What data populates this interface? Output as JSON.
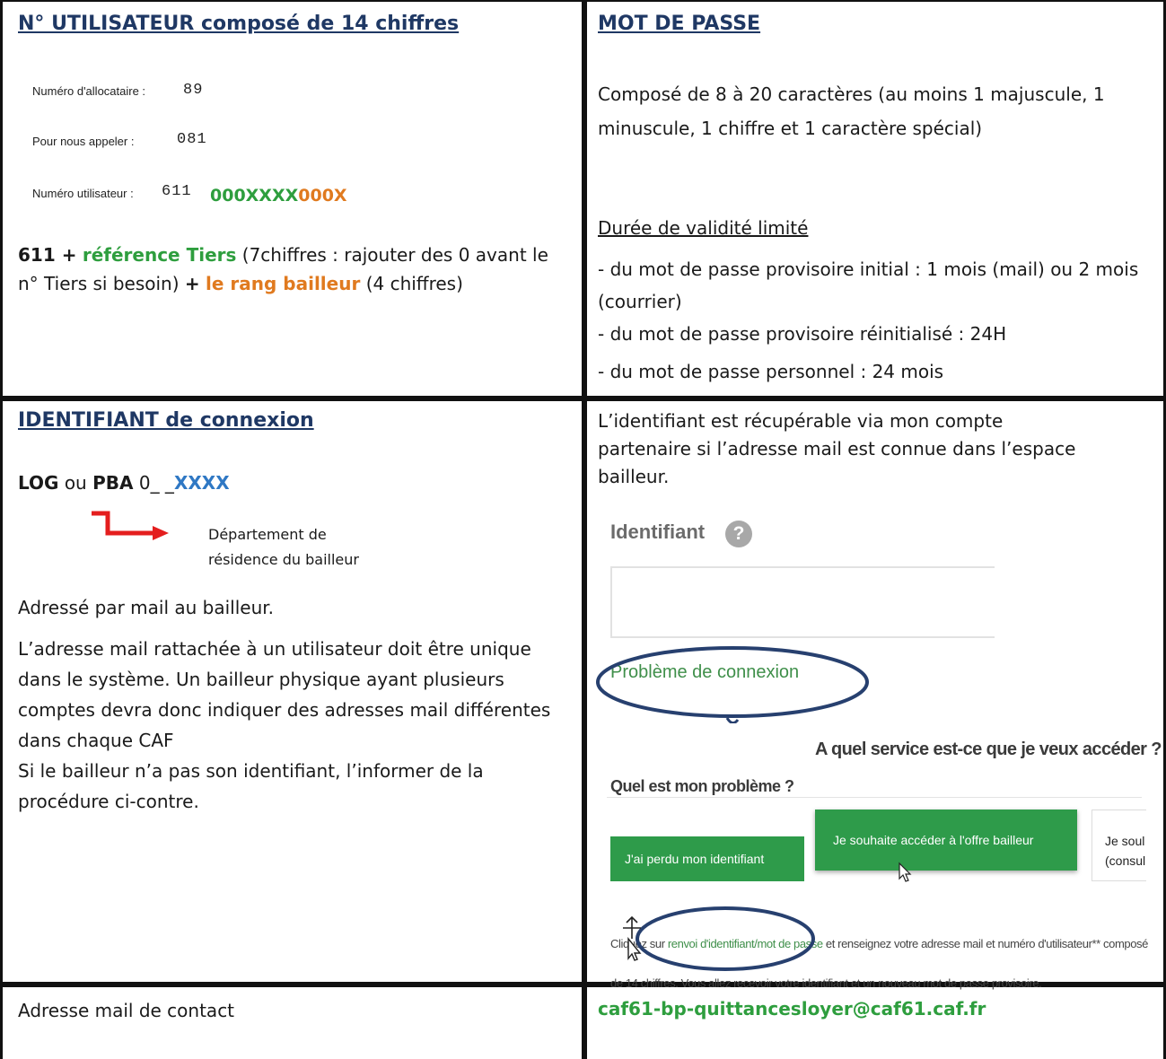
{
  "cells": {
    "user_number": {
      "heading": "N° UTILISATEUR composé de 14 chiffres",
      "sample": {
        "alloc_label": "Numéro d'allocataire :",
        "alloc_value": "89",
        "phone_label": "Pour nous appeler :",
        "phone_value": "081",
        "user_label": "Numéro utilisateur :",
        "user_value": "611",
        "code_green": "000XXXX",
        "code_orange": "000X"
      },
      "explain": {
        "prefix": "611 +",
        "tiers": "référence Tiers",
        "tiers_note": "(7chiffres : rajouter des 0 avant le n° Tiers si besoin)",
        "plus": "+",
        "rang": "le rang bailleur",
        "rang_note": "(4 chiffres)"
      }
    },
    "password": {
      "heading": "MOT DE PASSE",
      "composition": "Composé de 8 à 20 caractères (au moins 1 majuscule, 1 minuscule, 1 chiffre et 1 caractère spécial)",
      "validity_title": "Durée de validité limité",
      "validity_lines": [
        "- du mot de passe provisoire initial : 1 mois (mail) ou 2 mois (courrier)",
        "- du mot de passe provisoire réinitialisé : 24H",
        "- du mot de passe personnel : 24 mois"
      ]
    },
    "login_id": {
      "heading": "IDENTIFIANT de connexion",
      "log": "LOG",
      "ou": "ou",
      "pba": "PBA",
      "zero": "0_ _",
      "xxxx": "XXXX",
      "dept_note_1": "Département de",
      "dept_note_2": "résidence du bailleur",
      "lines": [
        "Adressé par mail au bailleur.",
        "L’adresse mail rattachée à un utilisateur doit être unique dans le système. Un bailleur physique ayant plusieurs comptes devra donc indiquer des adresses mail différentes dans chaque CAF",
        "Si le bailleur n’a pas son identifiant, l’informer de la procédure ci-contre."
      ]
    },
    "recovery": {
      "intro": "L’identifiant est récupérable via mon compte partenaire si l’adresse mail est connue dans l’espace bailleur.",
      "identifiant_label": "Identifiant",
      "help_glyph": "?",
      "problem_link": "Problème de connexion",
      "service_question": "A quel service est-ce que je veux accéder ?",
      "problem_question": "Quel est mon problème ?",
      "btn_lost_id": "J'ai perdu mon identifiant",
      "btn_offer": "Je souhaite accéder à l'offre bailleur",
      "partial_1": "Je soul",
      "partial_2": "(consul",
      "instr_1": "Cliquez sur",
      "instr_link": "renvoi d'identifiant/mot de passe",
      "instr_2": "et renseignez votre adresse mail et numéro d'utilisateur** composé de 14",
      "instr_3": "chiffres. Vous allez recevoir votre identifiant et un nouveau mot de passe provisoire."
    },
    "contact": {
      "label": "Adresse mail de contact",
      "email": "caf61-bp-quittancesloyer@caf61.caf.fr"
    }
  },
  "colors": {
    "heading": "#1f3864",
    "green": "#2e9e3e",
    "orange": "#e07a1f",
    "blue": "#2f78c4",
    "arrow": "#e41e1e",
    "ellipse": "#27406f",
    "button_green": "#2e9b4a"
  }
}
